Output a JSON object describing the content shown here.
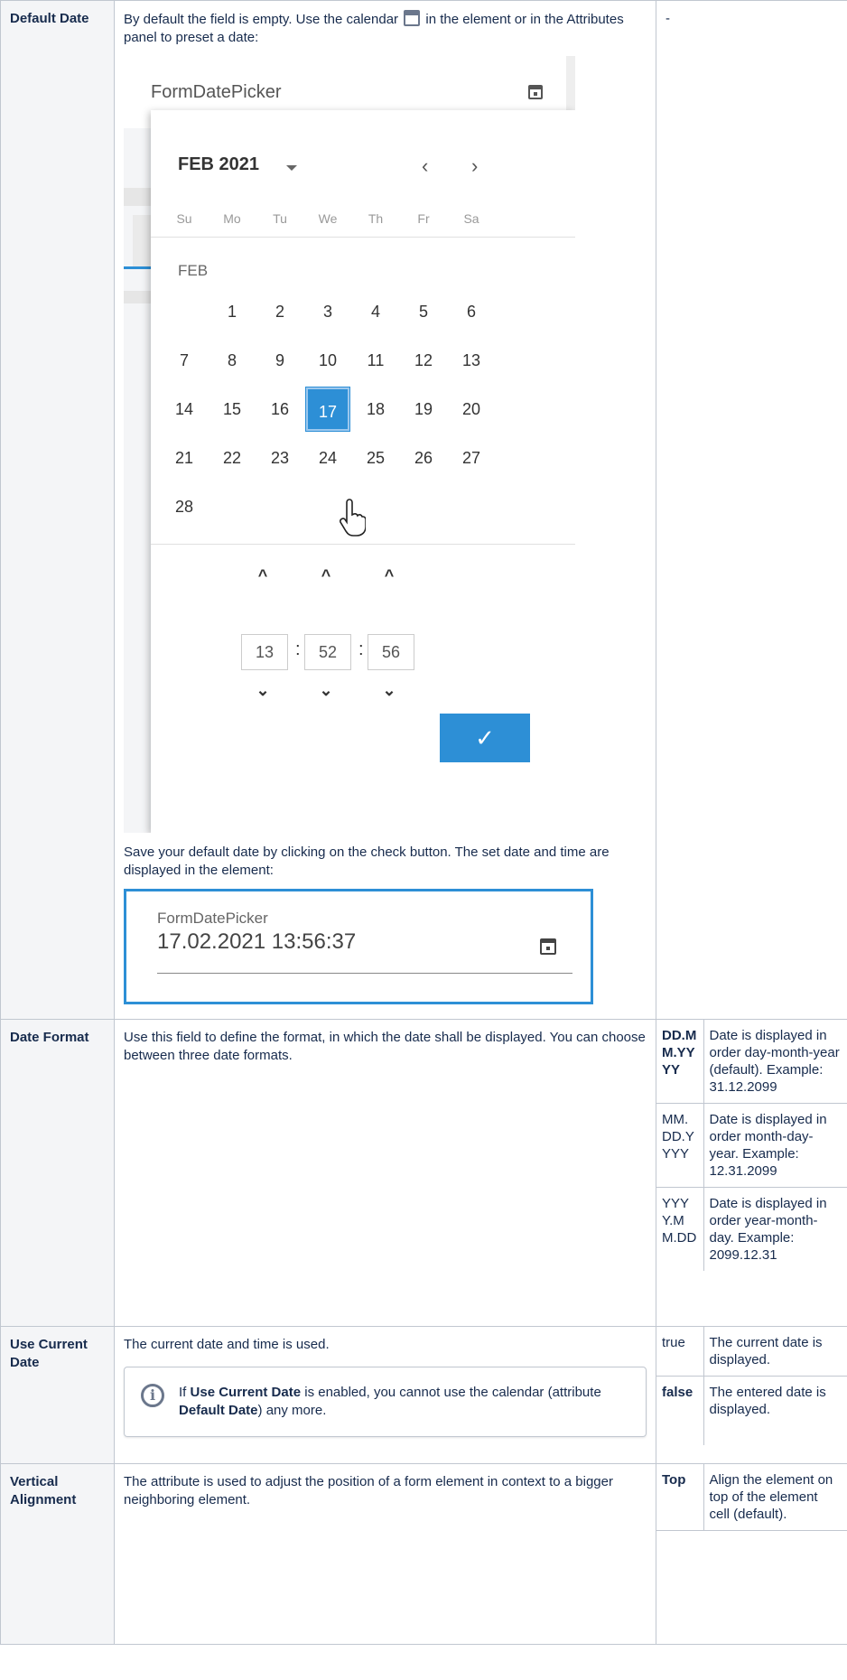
{
  "rows": {
    "default_date": {
      "name": "Default Date",
      "desc_before_icon": "By default the field is empty. Use the calendar",
      "desc_after_icon": " in the element or in the Attributes panel to preset a date:",
      "value": "-",
      "picker": {
        "field_label": "FormDatePicker",
        "month_year": "FEB 2021",
        "prev": "‹",
        "next": "›",
        "weekdays": [
          "Su",
          "Mo",
          "Tu",
          "We",
          "Th",
          "Fr",
          "Sa"
        ],
        "month_label": "FEB",
        "days": [
          "1",
          "2",
          "3",
          "4",
          "5",
          "6",
          "7",
          "8",
          "9",
          "10",
          "11",
          "12",
          "13",
          "14",
          "15",
          "16",
          "17",
          "18",
          "19",
          "20",
          "21",
          "22",
          "23",
          "24",
          "25",
          "26",
          "27",
          "28"
        ],
        "selected_day": "17",
        "hours": "13",
        "minutes": "52",
        "seconds": "56",
        "time_sep": ":",
        "up": "^",
        "down": "⌄",
        "ok": "✓"
      },
      "save_text": "Save your default date by clicking on the check button. The set date and time are displayed in the element:",
      "result": {
        "label": "FormDatePicker",
        "value": "17.02.2021 13:56:37"
      }
    },
    "date_format": {
      "name": "Date Format",
      "desc": "Use this field to define the format, in which the date shall be displayed. You can choose between three date formats.",
      "options": [
        {
          "key": "DD.MM.YYYY",
          "text": "Date is displayed in order day-month-year (default). Example: 31.12.2099"
        },
        {
          "key": "MM.DD.YYYY",
          "text": "Date is displayed in order month-day-year. Example: 12.31.2099"
        },
        {
          "key": "YYYY.MM.DD",
          "text": "Date is displayed in order year-month-day. Example: 2099.12.31"
        }
      ]
    },
    "use_current_date": {
      "name": "Use Current Date",
      "desc": "The current date and time is used.",
      "note_pre": "If ",
      "note_b1": "Use Current Date",
      "note_mid": " is enabled, you cannot use the calendar (attribute ",
      "note_b2": "Default Date",
      "note_post": ") any more.",
      "options": [
        {
          "key": "true",
          "text": "The current date is displayed."
        },
        {
          "key": "false",
          "text": "The entered date is displayed."
        }
      ]
    },
    "vertical_alignment": {
      "name": "Vertical Alignment",
      "desc": "The attribute is used to adjust the position of a form element in context to a bigger neighboring element.",
      "options": [
        {
          "key": "Top",
          "text": "Align the element on top of the element cell (default)."
        }
      ]
    }
  }
}
